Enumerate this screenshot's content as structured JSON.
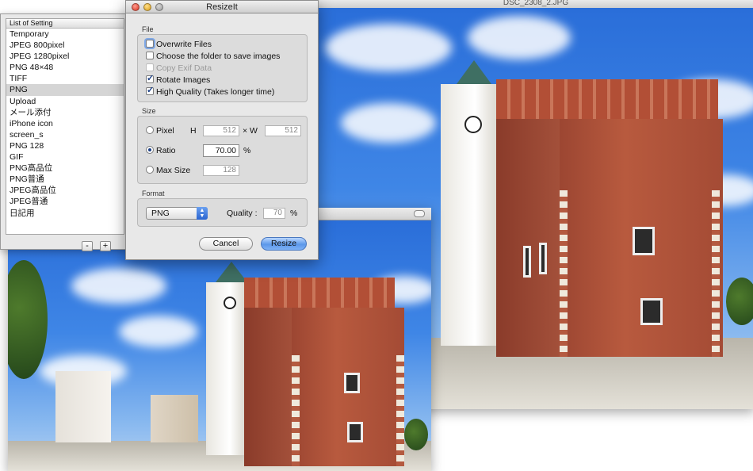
{
  "photo_window": {
    "title": "DSC_2308_2.JPG"
  },
  "list_panel": {
    "header": "List of Setting",
    "items": [
      "Temporary",
      "JPEG 800pixel",
      "JPEG 1280pixel",
      "PNG 48×48",
      "TIFF",
      "PNG",
      "Upload",
      "メール添付",
      "iPhone icon",
      "screen_s",
      "PNG 128",
      "GIF",
      "PNG高品位",
      "PNG普通",
      "JPEG高品位",
      "JPEG普通",
      "日記用"
    ],
    "selected": "PNG",
    "remove_label": "-",
    "add_label": "+"
  },
  "dialog": {
    "title": "ResizeIt",
    "file_section": {
      "label": "File",
      "overwrite_files": {
        "label": "Overwrite Files",
        "checked": false
      },
      "choose_folder": {
        "label": "Choose the folder to save images",
        "checked": false
      },
      "copy_exif": {
        "label": "Copy Exif Data",
        "checked": false,
        "disabled": true
      },
      "rotate_images": {
        "label": "Rotate Images",
        "checked": true
      },
      "high_quality": {
        "label": "High Quality (Takes longer time)",
        "checked": true
      }
    },
    "size_section": {
      "label": "Size",
      "pixel_label": "Pixel",
      "h_label": "H",
      "h_value": "512",
      "times": "× W",
      "w_value": "512",
      "ratio_label": "Ratio",
      "ratio_value": "70.00",
      "percent": "%",
      "max_size_label": "Max Size",
      "max_size_value": "128",
      "selected": "Ratio"
    },
    "format_section": {
      "label": "Format",
      "format_value": "PNG",
      "quality_label": "Quality :",
      "quality_value": "70",
      "percent": "%"
    },
    "cancel_label": "Cancel",
    "resize_label": "Resize"
  },
  "colors": {
    "sky": "#3f86e6",
    "brick": "#b85a3e",
    "accent_button": "#5c98ea"
  }
}
